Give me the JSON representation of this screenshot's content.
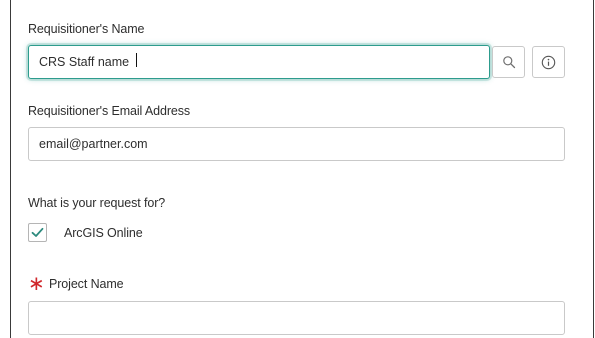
{
  "form": {
    "requisitioner_name": {
      "label": "Requisitioner's Name",
      "value": "CRS Staff name",
      "search_icon": "search-icon",
      "info_icon": "info-icon"
    },
    "requisitioner_email": {
      "label": "Requisitioner's Email Address",
      "value": "email@partner.com"
    },
    "request_for": {
      "question": "What is your request for?",
      "options": [
        {
          "label": "ArcGIS Online",
          "checked": true
        }
      ]
    },
    "project_name": {
      "required_marker": "∗",
      "label": "Project Name",
      "value": ""
    }
  },
  "colors": {
    "focus_border": "#2d9c8d",
    "check_mark": "#2d8b7e",
    "required": "#d0272b",
    "input_border": "#c9c9c9"
  }
}
